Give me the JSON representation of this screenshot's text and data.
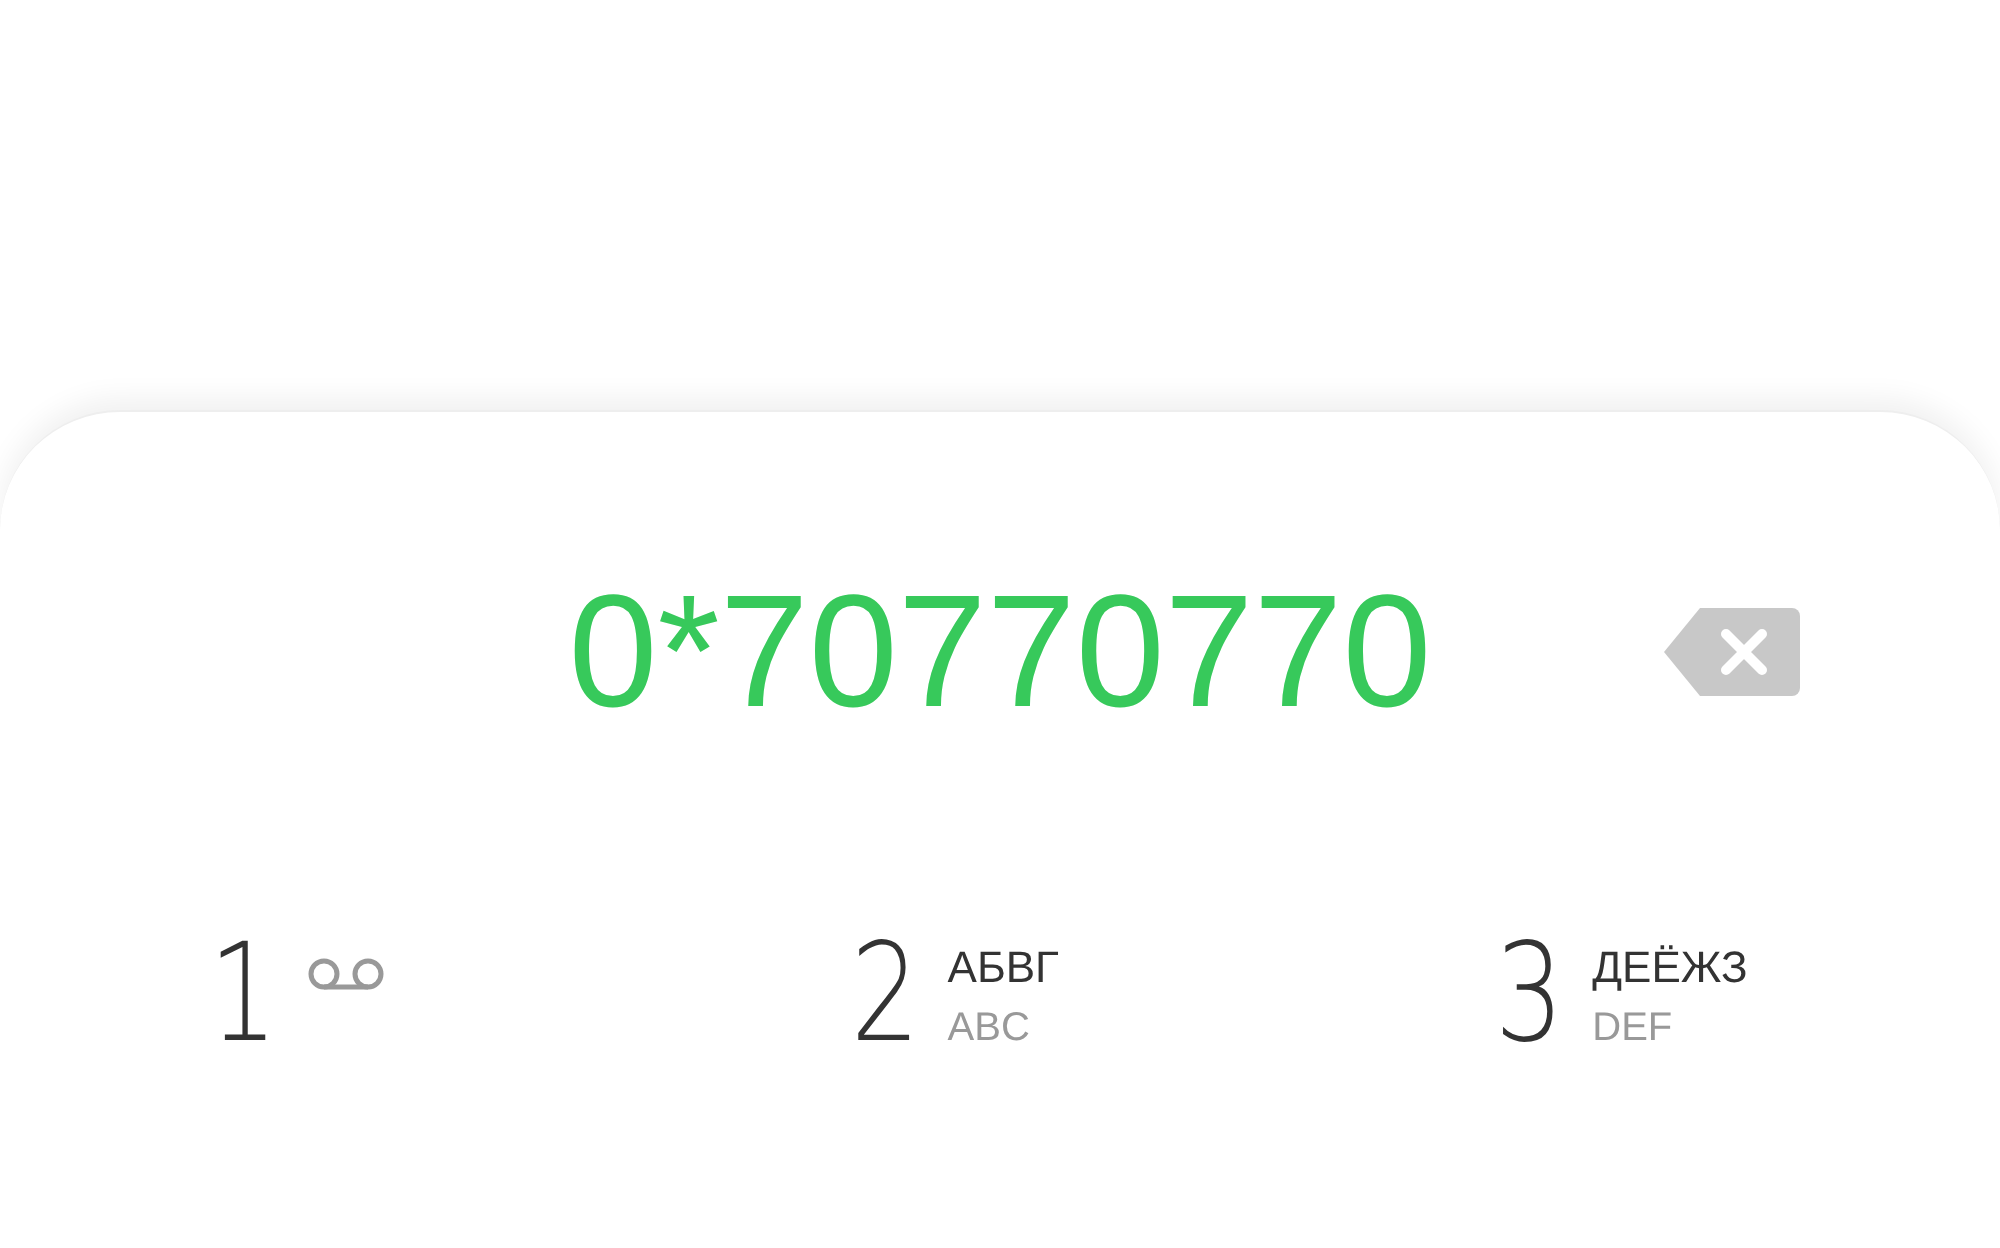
{
  "dialer": {
    "number": "0*70770770",
    "keys": [
      {
        "kind": "voicemail",
        "digit": "1"
      },
      {
        "kind": "letters",
        "digit": "2",
        "letters": "АБВГ",
        "latin": "ABC"
      },
      {
        "kind": "letters",
        "digit": "3",
        "letters": "ДЕЁЖЗ",
        "latin": "DEF"
      }
    ]
  }
}
